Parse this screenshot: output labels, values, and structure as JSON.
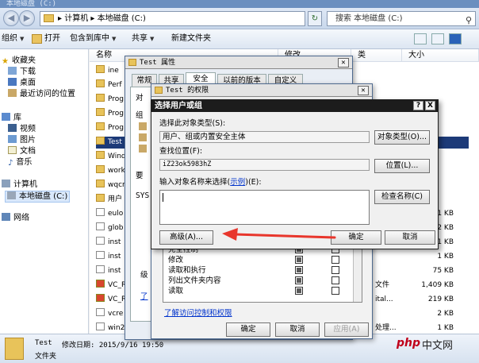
{
  "explorer": {
    "title": "本地磁盘 (C:)",
    "breadcrumb": [
      "计算机",
      "本地磁盘 (C:)"
    ],
    "search_placeholder": "搜索 本地磁盘 (C:)",
    "toolbar": {
      "organize": "组织",
      "open": "打开",
      "include_in_library": "包含到库中",
      "share": "共享",
      "new_folder": "新建文件夹"
    },
    "columns": {
      "name": "名称",
      "modified": "修改",
      "type": "类",
      "size": "大小"
    },
    "nav": {
      "favorites": "收藏夹",
      "downloads": "下载",
      "desktop": "桌面",
      "recent": "最近访问的位置",
      "libraries": "库",
      "videos": "视频",
      "pictures": "图片",
      "documents": "文档",
      "music": "音乐",
      "computer": "计算机",
      "local_disk": "本地磁盘 (C:)",
      "network": "网络"
    },
    "files": [
      {
        "name": "ine",
        "kind": "folder",
        "size": "",
        "type": ""
      },
      {
        "name": "Perf",
        "kind": "folder",
        "size": "",
        "type": ""
      },
      {
        "name": "Prog",
        "kind": "folder",
        "size": "",
        "type": ""
      },
      {
        "name": "Prog",
        "kind": "folder",
        "size": "",
        "type": ""
      },
      {
        "name": "Prog",
        "kind": "folder",
        "size": "",
        "type": ""
      },
      {
        "name": "Test",
        "kind": "folder",
        "size": "",
        "type": ""
      },
      {
        "name": "Wind",
        "kind": "folder",
        "size": "",
        "type": ""
      },
      {
        "name": "work",
        "kind": "folder",
        "size": "",
        "type": ""
      },
      {
        "name": "wqcn",
        "kind": "folder",
        "size": "",
        "type": ""
      },
      {
        "name": "用户",
        "kind": "folder",
        "size": "",
        "type": ""
      },
      {
        "name": "eulo",
        "kind": "file",
        "size": "1 KB",
        "type": ""
      },
      {
        "name": "glob",
        "kind": "file",
        "size": "2 KB",
        "type": ""
      },
      {
        "name": "inst",
        "kind": "file",
        "size": "1 KB",
        "type": ""
      },
      {
        "name": "inst",
        "kind": "file",
        "size": "1 KB",
        "type": ""
      },
      {
        "name": "inst",
        "kind": "file",
        "size": "75 KB",
        "type": ""
      },
      {
        "name": "VC_R",
        "kind": "app",
        "size": "1,409 KB",
        "type": "文件"
      },
      {
        "name": "VC_R",
        "kind": "app",
        "size": "219 KB",
        "type": "ital..."
      },
      {
        "name": "vcre",
        "kind": "file",
        "size": "2 KB",
        "type": ""
      },
      {
        "name": "win2",
        "kind": "file",
        "size": "1 KB",
        "type": "处理..."
      }
    ],
    "details": {
      "name": "Test",
      "modified": "修改日期: 2015/9/16 19:50",
      "type": "文件夹"
    }
  },
  "properties_dialog": {
    "title": "Test 属性",
    "tabs": [
      "常规",
      "共享",
      "安全",
      "以前的版本",
      "自定义"
    ],
    "body_fragments": [
      "对",
      "组",
      "要",
      "SYS"
    ]
  },
  "permissions_dialog": {
    "title": "Test 的权限",
    "permissions": [
      {
        "label": "完全控制",
        "allow": true,
        "deny": false
      },
      {
        "label": "修改",
        "allow": true,
        "deny": false
      },
      {
        "label": "读取和执行",
        "allow": true,
        "deny": false
      },
      {
        "label": "列出文件夹内容",
        "allow": true,
        "deny": false
      },
      {
        "label": "读取",
        "allow": true,
        "deny": false
      }
    ],
    "link": "了解访问控制和权限",
    "ok": "确定",
    "cancel": "取消",
    "apply": "应用(A)",
    "side_fragment": "级",
    "side_link": "了"
  },
  "select_dialog": {
    "title": "选择用户或组",
    "help": "?",
    "close": "X",
    "object_type_label": "选择此对象类型(S):",
    "object_type_value": "用户、组或内置安全主体",
    "object_type_button": "对象类型(O)...",
    "location_label": "查找位置(F):",
    "location_value": "iZ23ok5983hZ",
    "location_button": "位置(L)...",
    "names_label_pre": "输入对象名称来选择(",
    "names_label_link": "示例",
    "names_label_post": ")(E):",
    "names_value": "",
    "check_names_button": "检查名称(C)",
    "advanced_button": "高级(A)...",
    "ok_button": "确定",
    "cancel_button": "取消"
  },
  "watermark": {
    "logo": "php",
    "text": "中文网"
  },
  "colors": {
    "accent_arrow": "#e8362c",
    "selection": "#1c3a78",
    "dialog_title": "#1c1c1c"
  }
}
